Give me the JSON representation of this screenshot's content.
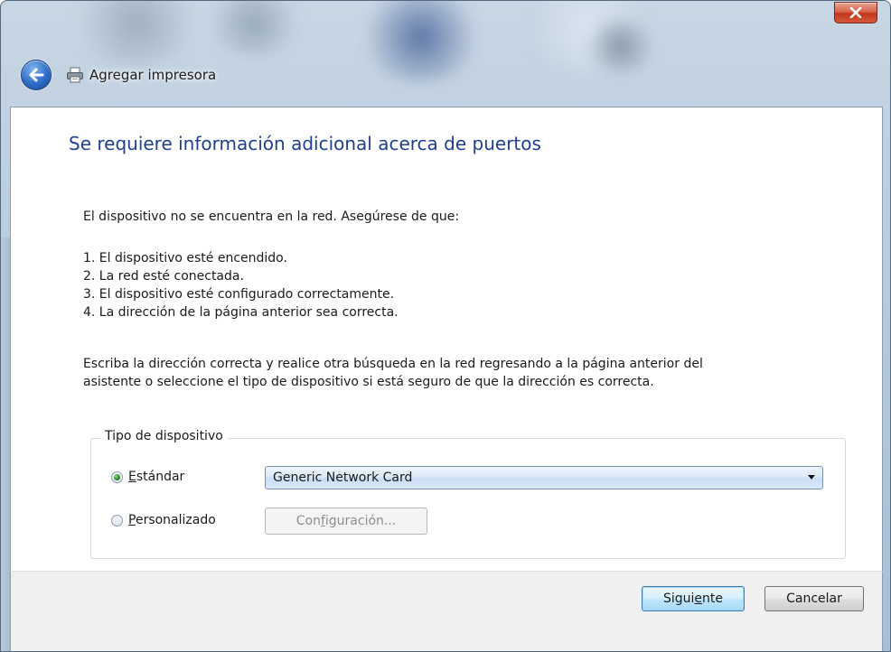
{
  "window": {
    "title": "Agregar impresora"
  },
  "content": {
    "heading": "Se requiere información adicional acerca de puertos",
    "intro": "El dispositivo no se encuentra en la red. Asegúrese de que:",
    "steps": [
      "1. El dispositivo esté encendido.",
      "2. La red esté conectada.",
      "3. El dispositivo esté configurado correctamente.",
      "4. La dirección de la página anterior sea correcta."
    ],
    "paragraph_line1": "Escriba la dirección correcta y realice otra búsqueda en la red regresando a la página anterior del",
    "paragraph_line2": "asistente o seleccione el tipo de dispositivo si está seguro de que la dirección es correcta."
  },
  "device_type": {
    "legend": "Tipo de dispositivo",
    "standard_label_first": "E",
    "standard_label_rest": "stándar",
    "standard_selected": true,
    "custom_label_first": "P",
    "custom_label_rest": "ersonalizado",
    "custom_selected": false,
    "dropdown_value": "Generic Network Card",
    "config_label_pre": "Con",
    "config_label_u": "f",
    "config_label_post": "iguración...",
    "config_enabled": false
  },
  "footer": {
    "next_pre": "Sigui",
    "next_u": "e",
    "next_post": "nte",
    "cancel_label": "Cancelar"
  },
  "icons": {
    "close": "close-icon",
    "back": "back-arrow-icon",
    "printer": "printer-icon",
    "dropdown": "chevron-down-icon"
  },
  "colors": {
    "heading": "#1f3f8f",
    "close_button": "#c1361b",
    "primary_button_border": "#3c7fb1"
  }
}
